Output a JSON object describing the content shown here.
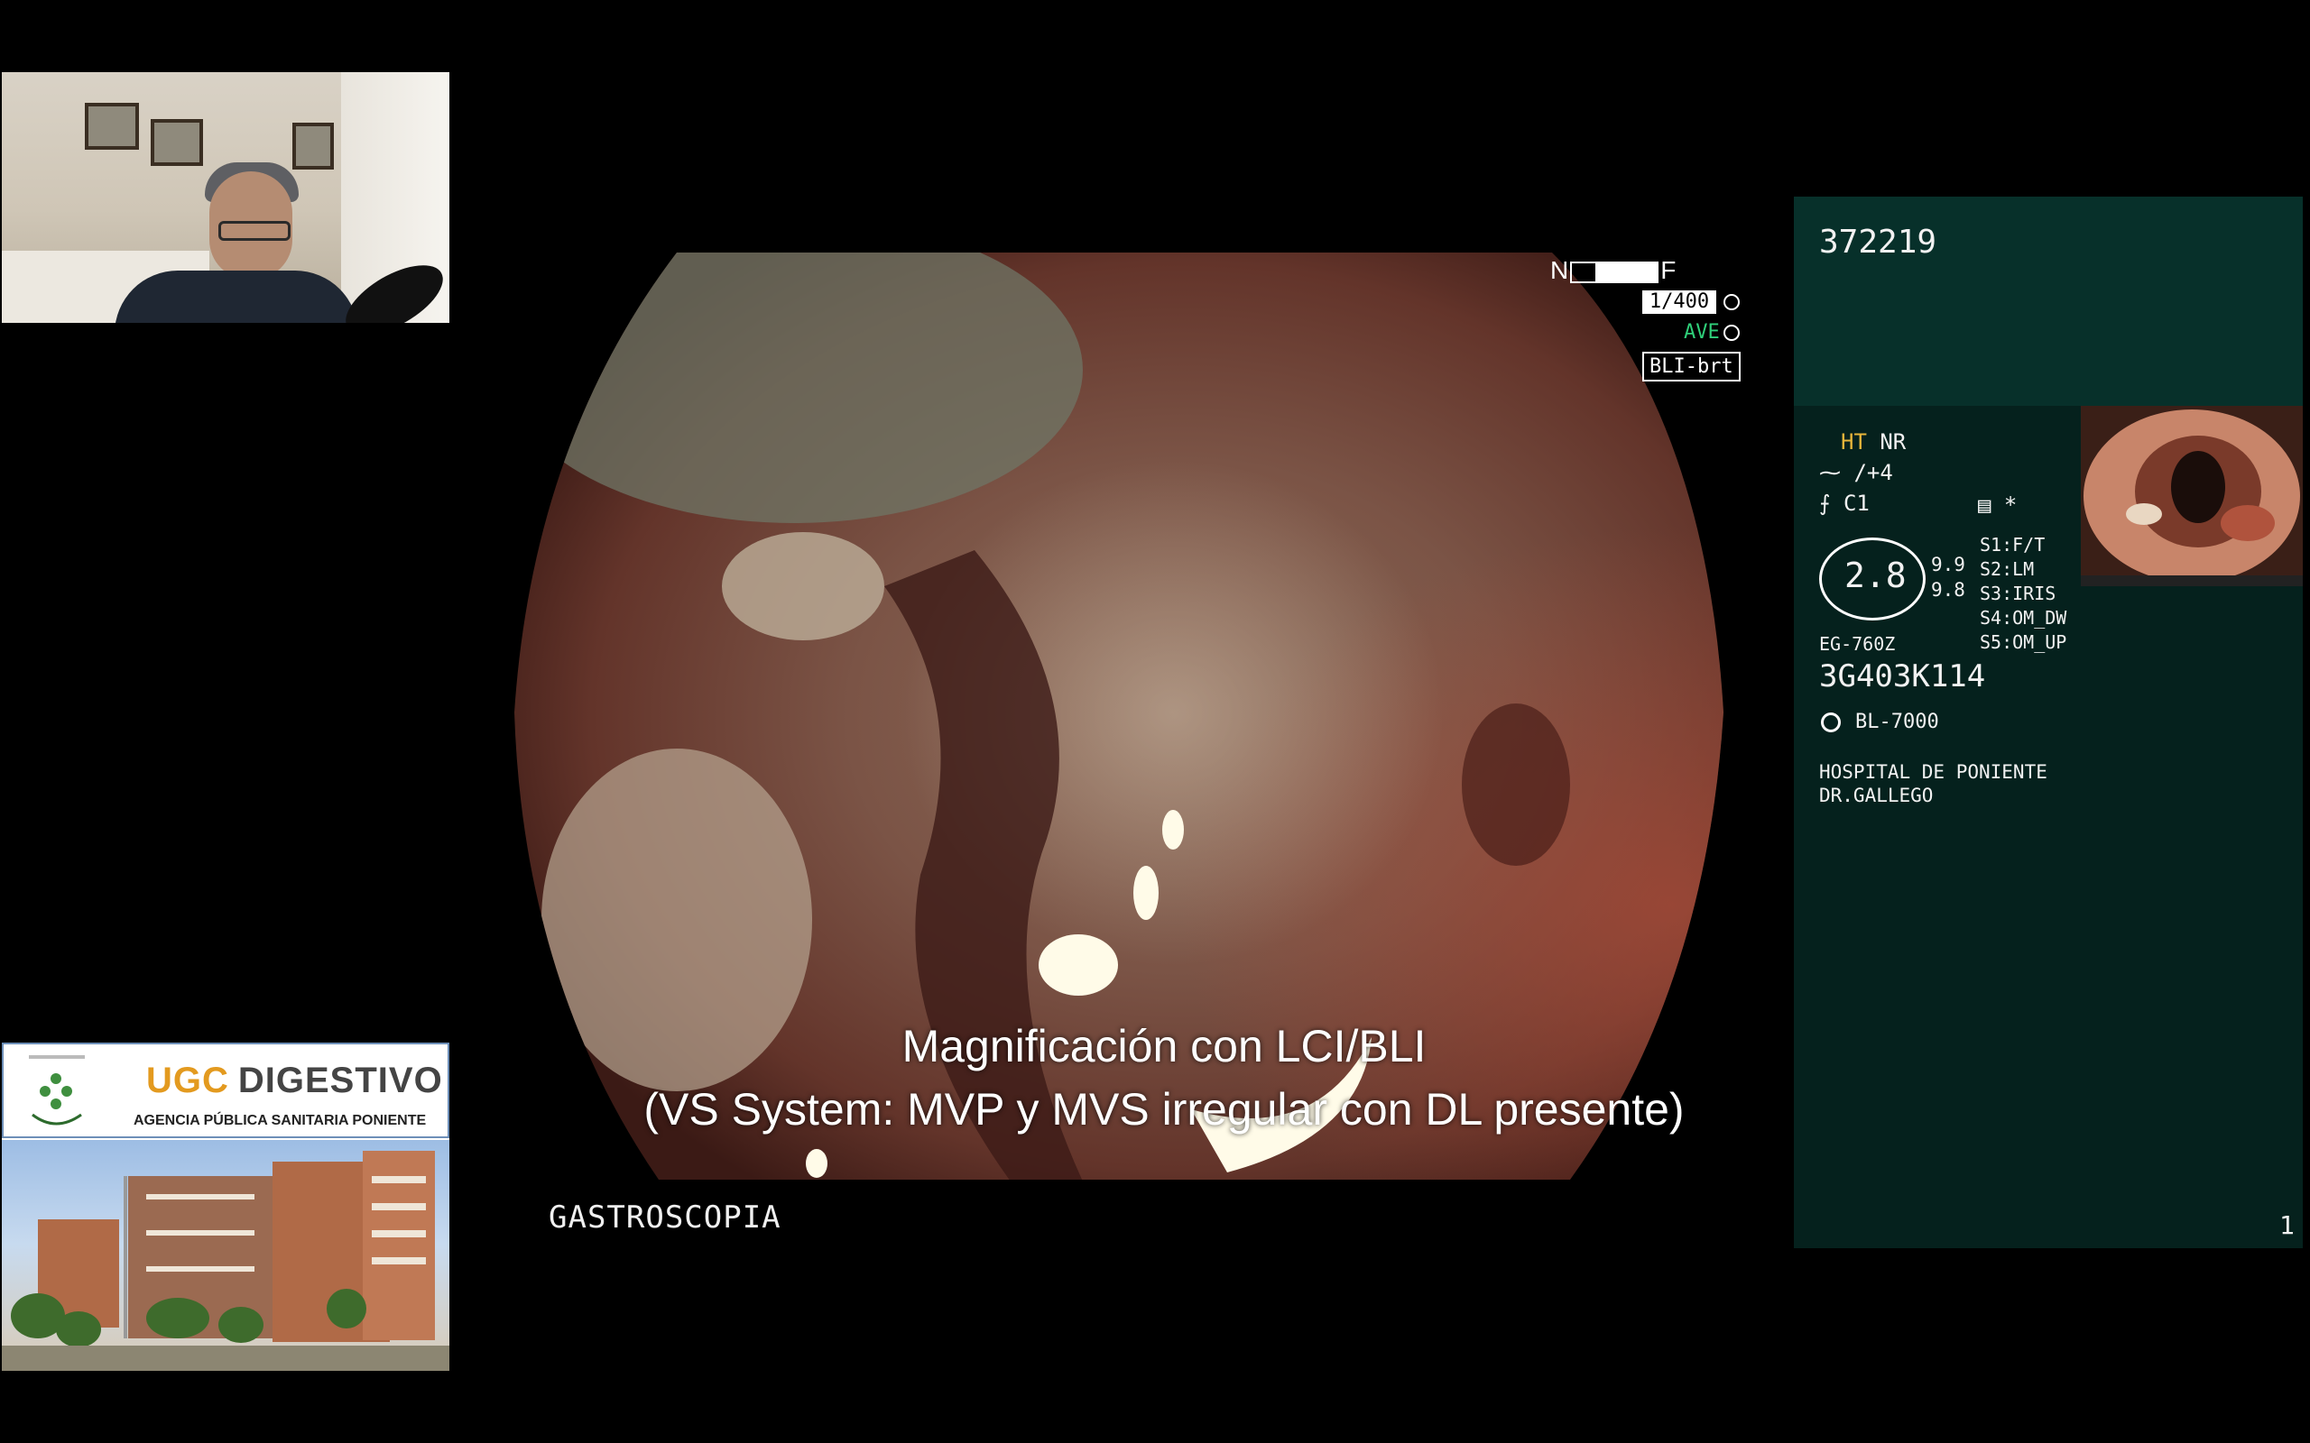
{
  "webcam": {
    "label": ""
  },
  "logo_tile": {
    "ugc": "UGC",
    "digestivo": "DIGESTIVO",
    "agency": "AGENCIA PÚBLICA SANITARIA PONIENTE",
    "building_sign": "Hospital de Poniente"
  },
  "overlay": {
    "nf_near": "N",
    "nf_far": "F",
    "shutter": "1/400",
    "average": "AVE",
    "mode": "BLI-brt"
  },
  "subtitle": {
    "line1": "Magnificación con LCI/BLI",
    "line2": "(VS System: MVP y MVS irregular con DL presente)"
  },
  "exam": "GASTROSCOPIA",
  "panel": {
    "patient_id": "372219",
    "ht": "HT",
    "nr": "NR",
    "enhancement": "/+4",
    "color": "C1",
    "menu": "*",
    "zoom": "2.8",
    "zoom_a": "9.9",
    "zoom_b": "9.8",
    "switches": [
      "S1:F/T",
      "S2:LM",
      "S3:IRIS",
      "S4:OM_DW",
      "S5:OM_UP"
    ],
    "scope_model": "EG-760Z",
    "serial": "3G403K114",
    "light_source": "BL-7000",
    "hospital": "HOSPITAL DE PONIENTE",
    "doctor": "DR.GALLEGO",
    "page": "1"
  },
  "colors": {
    "panel_bg": "#05211d",
    "ht_accent": "#e8b53a",
    "ave_green": "#2fd07a",
    "ugc_orange": "#e39a1f"
  }
}
